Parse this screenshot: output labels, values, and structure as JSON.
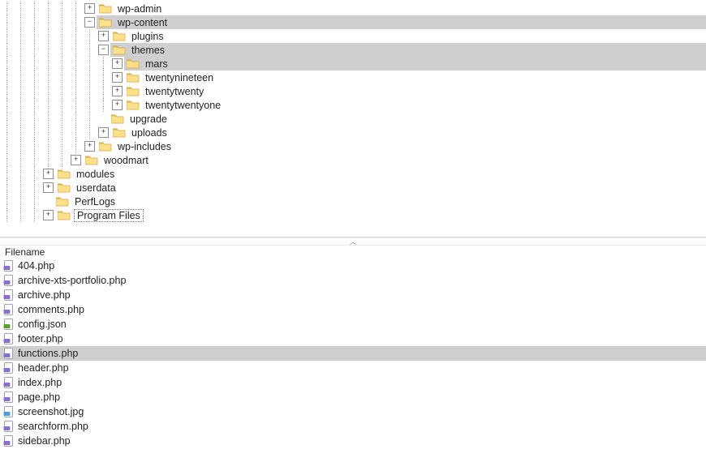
{
  "tree": [
    {
      "indent": 6,
      "expander": "plus",
      "label": "wp-admin"
    },
    {
      "indent": 6,
      "expander": "minus",
      "label": "wp-content",
      "highlight": true
    },
    {
      "indent": 7,
      "expander": "plus",
      "label": "plugins"
    },
    {
      "indent": 7,
      "expander": "minus",
      "label": "themes",
      "highlight": true
    },
    {
      "indent": 8,
      "expander": "plus",
      "label": "mars",
      "highlight": true
    },
    {
      "indent": 8,
      "expander": "plus",
      "label": "twentynineteen"
    },
    {
      "indent": 8,
      "expander": "plus",
      "label": "twentytwenty"
    },
    {
      "indent": 8,
      "expander": "plus",
      "label": "twentytwentyone"
    },
    {
      "indent": 7,
      "expander": "none",
      "label": "upgrade"
    },
    {
      "indent": 7,
      "expander": "plus",
      "label": "uploads"
    },
    {
      "indent": 6,
      "expander": "plus",
      "label": "wp-includes"
    },
    {
      "indent": 5,
      "expander": "plus",
      "label": "woodmart"
    },
    {
      "indent": 3,
      "expander": "plus",
      "label": "modules"
    },
    {
      "indent": 3,
      "expander": "plus",
      "label": "userdata"
    },
    {
      "indent": 3,
      "expander": "none",
      "label": "PerfLogs"
    },
    {
      "indent": 3,
      "expander": "plus",
      "label": "Program Files",
      "box": true
    }
  ],
  "list_header": "Filename",
  "files": [
    {
      "name": "404.php",
      "icon": "php"
    },
    {
      "name": "archive-xts-portfolio.php",
      "icon": "php"
    },
    {
      "name": "archive.php",
      "icon": "php"
    },
    {
      "name": "comments.php",
      "icon": "php"
    },
    {
      "name": "config.json",
      "icon": "json"
    },
    {
      "name": "footer.php",
      "icon": "php"
    },
    {
      "name": "functions.php",
      "icon": "php",
      "selected": true
    },
    {
      "name": "header.php",
      "icon": "php"
    },
    {
      "name": "index.php",
      "icon": "php"
    },
    {
      "name": "page.php",
      "icon": "php"
    },
    {
      "name": "screenshot.jpg",
      "icon": "img"
    },
    {
      "name": "searchform.php",
      "icon": "php"
    },
    {
      "name": "sidebar.php",
      "icon": "php"
    }
  ]
}
